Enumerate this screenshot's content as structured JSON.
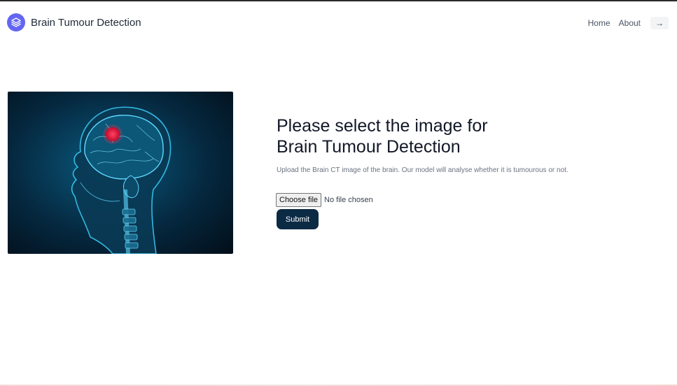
{
  "header": {
    "brand": "Brain Tumour Detection",
    "nav": {
      "home": "Home",
      "about": "About",
      "arrow": "→"
    }
  },
  "main": {
    "title_line1": "Please select the image for",
    "title_line2": "Brain Tumour Detection",
    "description": "Upload the Brain CT image of the brain. Our model will analyse whether it is tumourous or not.",
    "file_button": "Choose file",
    "file_status": "No file chosen",
    "submit": "Submit"
  },
  "colors": {
    "logo": "#6366f1",
    "submit_bg": "#0b2a44",
    "tumour_highlight": "#e0183c",
    "brain_glow": "#1fb7e6"
  },
  "icons": {
    "logo": "layers-icon",
    "nav_arrow": "arrow-right-icon"
  }
}
